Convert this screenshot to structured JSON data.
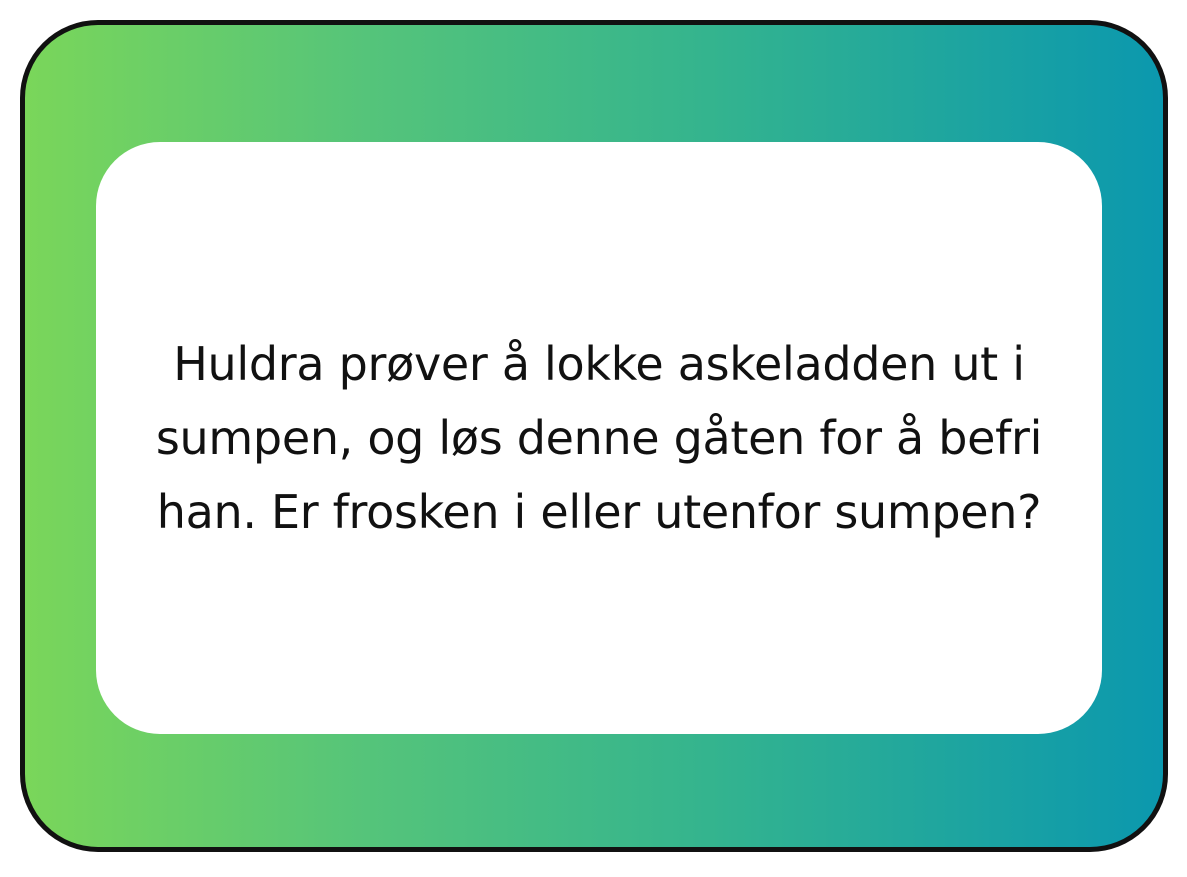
{
  "card": {
    "text": "Huldra prøver å lokke askeladden ut i sumpen, og løs denne gåten for å befri han. Er frosken i eller utenfor sumpen?",
    "colors": {
      "gradient_start": "#7ad65a",
      "gradient_end": "#0b98ae",
      "border": "#111111",
      "panel": "#ffffff",
      "text": "#111111"
    }
  }
}
